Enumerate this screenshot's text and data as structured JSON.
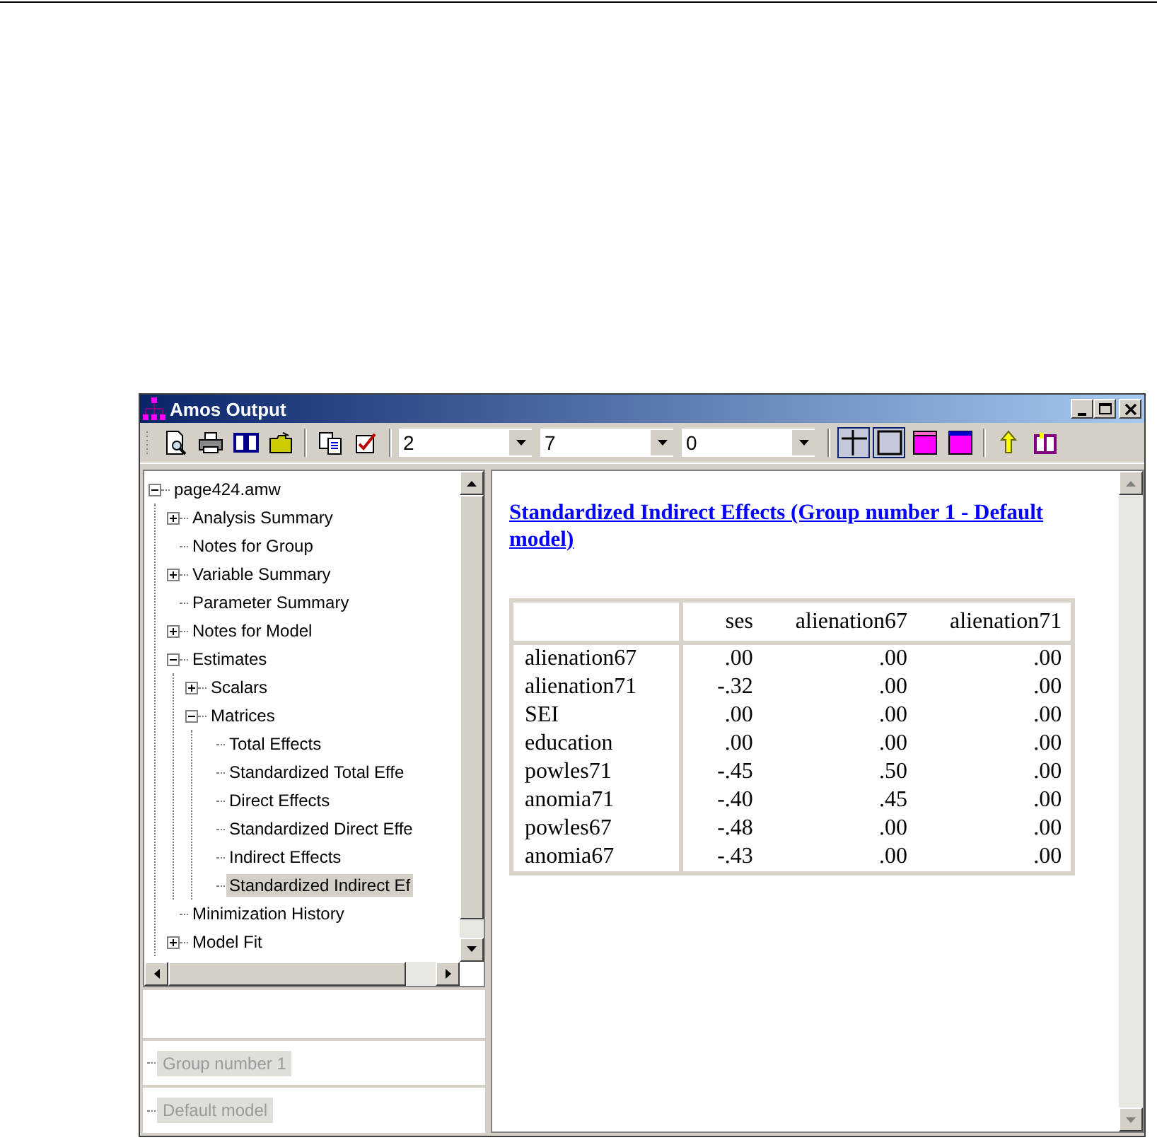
{
  "window": {
    "title": "Amos Output"
  },
  "toolbar": {
    "combos": [
      {
        "value": "2"
      },
      {
        "value": "7"
      },
      {
        "value": "0"
      }
    ],
    "view_buttons": [
      {
        "pressed": true
      },
      {
        "pressed": true
      },
      {
        "pressed": false
      },
      {
        "pressed": false
      }
    ]
  },
  "tree": [
    {
      "label": "page424.amw",
      "expanded": true,
      "selected": false,
      "children": [
        {
          "label": "Analysis Summary",
          "expanded": false,
          "selected": false
        },
        {
          "label": "Notes for Group",
          "selected": false
        },
        {
          "label": "Variable Summary",
          "expanded": false,
          "selected": false
        },
        {
          "label": "Parameter Summary",
          "selected": false
        },
        {
          "label": "Notes for Model",
          "expanded": false,
          "selected": false
        },
        {
          "label": "Estimates",
          "expanded": true,
          "selected": false,
          "children": [
            {
              "label": "Scalars",
              "expanded": false,
              "selected": false
            },
            {
              "label": "Matrices",
              "expanded": true,
              "selected": false,
              "children": [
                {
                  "label": "Total Effects",
                  "selected": false
                },
                {
                  "label": "Standardized Total Effe",
                  "selected": false
                },
                {
                  "label": "Direct Effects",
                  "selected": false
                },
                {
                  "label": "Standardized Direct Effe",
                  "selected": false
                },
                {
                  "label": "Indirect Effects",
                  "selected": false
                },
                {
                  "label": "Standardized Indirect Ef",
                  "selected": true
                }
              ]
            }
          ]
        },
        {
          "label": "Minimization History",
          "selected": false
        },
        {
          "label": "Model Fit",
          "expanded": false,
          "selected": false
        }
      ]
    }
  ],
  "groups": [
    {
      "label": "Group number 1",
      "selected": true
    }
  ],
  "models": [
    {
      "label": "Default model",
      "selected": true
    }
  ],
  "output": {
    "heading": "Standardized Indirect Effects (Group number 1 - Default model)",
    "table": {
      "columns": [
        "ses",
        "alienation67",
        "alienation71"
      ],
      "rows": [
        {
          "label": "alienation67",
          "values": [
            ".00",
            ".00",
            ".00"
          ]
        },
        {
          "label": "alienation71",
          "values": [
            "-.32",
            ".00",
            ".00"
          ]
        },
        {
          "label": "SEI",
          "values": [
            ".00",
            ".00",
            ".00"
          ]
        },
        {
          "label": "education",
          "values": [
            ".00",
            ".00",
            ".00"
          ]
        },
        {
          "label": "powles71",
          "values": [
            "-.45",
            ".50",
            ".00"
          ]
        },
        {
          "label": "anomia71",
          "values": [
            "-.40",
            ".45",
            ".00"
          ]
        },
        {
          "label": "powles67",
          "values": [
            "-.48",
            ".00",
            ".00"
          ]
        },
        {
          "label": "anomia67",
          "values": [
            "-.43",
            ".00",
            ".00"
          ]
        }
      ]
    }
  }
}
